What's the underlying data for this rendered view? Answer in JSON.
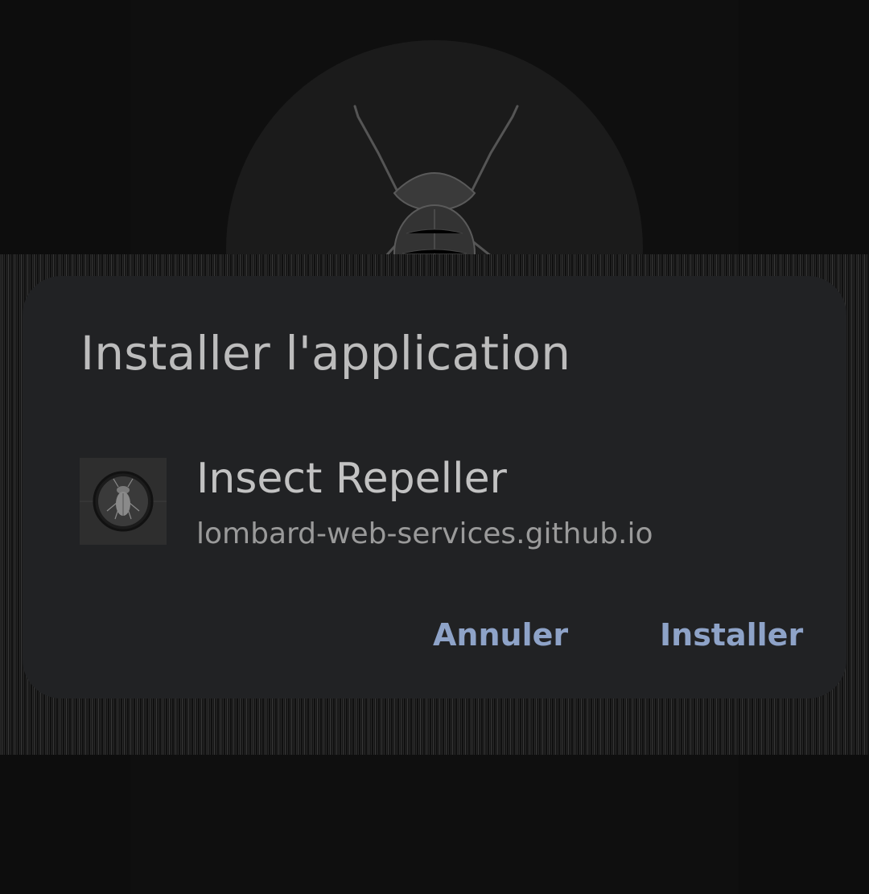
{
  "dialog": {
    "title": "Installer l'application",
    "app_name": "Insect Repeller",
    "app_source": "lombard-web-services.github.io",
    "cancel_label": "Annuler",
    "install_label": "Installer"
  },
  "icons": {
    "background": "insect-illustration-icon",
    "app": "fly-app-icon"
  },
  "colors": {
    "dialog_background": "#212224",
    "button_text": "#8ea3c8",
    "title_text": "#bcbcbc"
  }
}
